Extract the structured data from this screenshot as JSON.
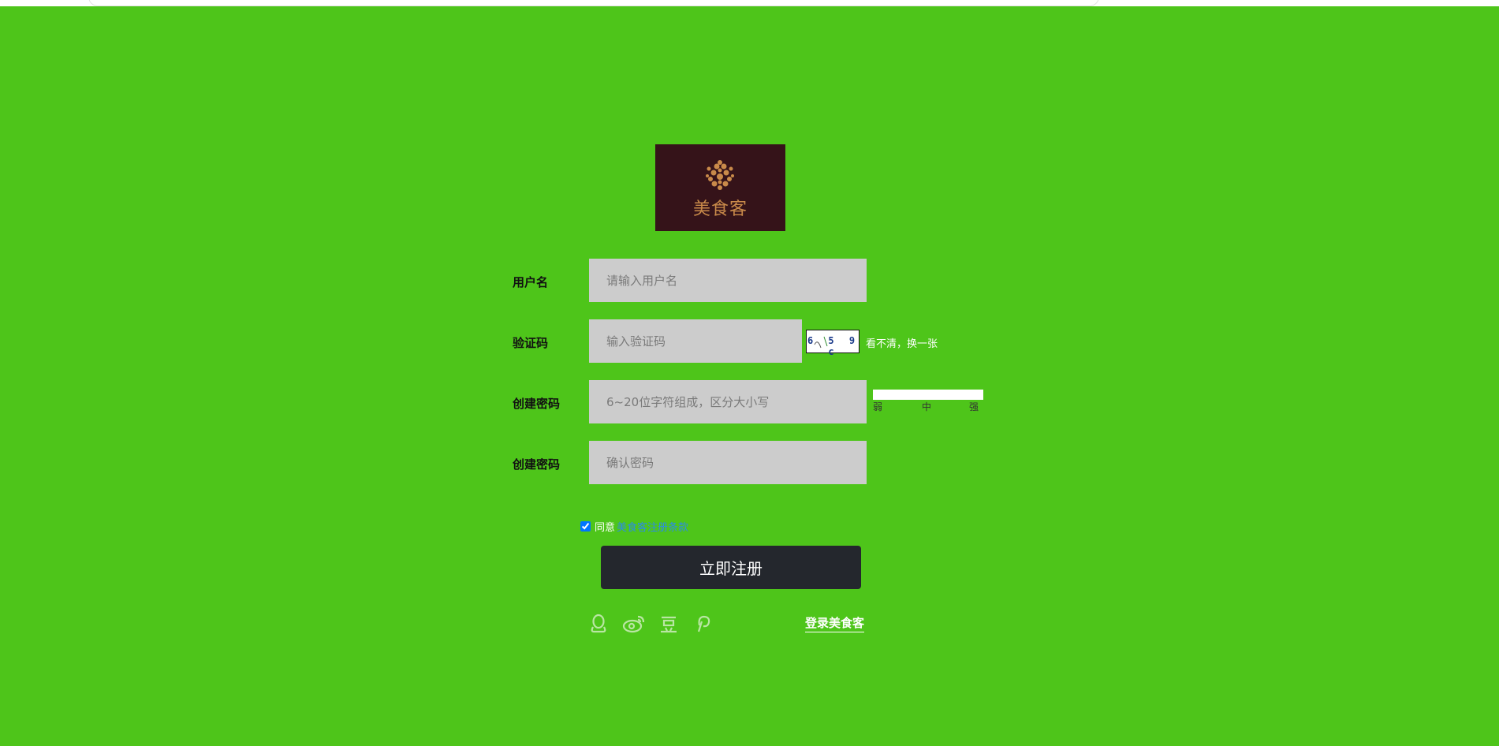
{
  "brand": {
    "logo_text": "美食客",
    "logo_bg": "#351319",
    "logo_text_color": "#c98a4a"
  },
  "theme": {
    "page_bg": "#4ec51a",
    "field_bg": "#cccccc",
    "button_bg": "#24272d",
    "link_color": "#2c8ce6"
  },
  "form": {
    "username": {
      "label": "用户名",
      "placeholder": "请输入用户名",
      "value": ""
    },
    "captcha": {
      "label": "验证码",
      "placeholder": "输入验证码",
      "value": "",
      "image_text": "6 5 9 c",
      "refresh_label": "看不清，换一张"
    },
    "password": {
      "label": "创建密码",
      "placeholder": "6~20位字符组成，区分大小写",
      "value": ""
    },
    "confirm_password": {
      "label": "创建密码",
      "placeholder": "确认密码",
      "value": ""
    },
    "strength": {
      "weak": "弱",
      "medium": "中",
      "strong": "强"
    },
    "agree": {
      "checked": true,
      "prefix": "同意",
      "link_text": "美食客注册条款"
    },
    "submit_label": "立即注册"
  },
  "social": {
    "icons": [
      "qq-icon",
      "weibo-icon",
      "douban-icon",
      "pinterest-icon"
    ],
    "login_label": "登录美食客"
  }
}
